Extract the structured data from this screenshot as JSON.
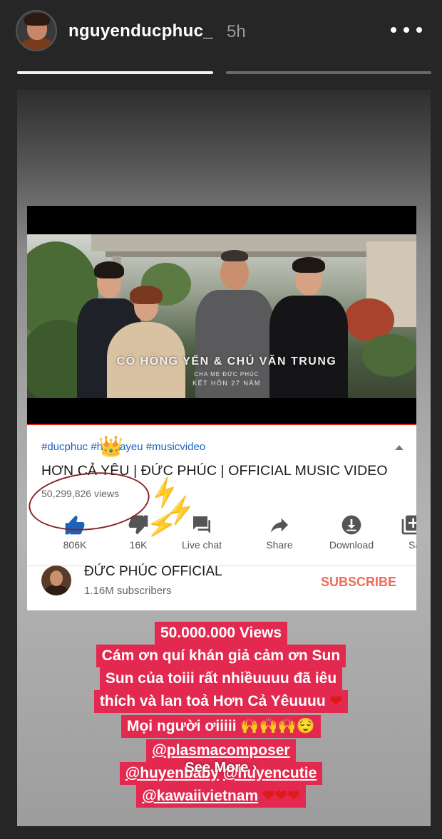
{
  "header": {
    "username": "nguyenducphuc_",
    "time": "5h"
  },
  "story": {
    "progress_fraction_segment_1": 1.0,
    "segment_count": 2
  },
  "youtube": {
    "video_caption_main": "CÔ HỒNG YẾN & CHÚ VĂN TRUNG",
    "video_caption_sub": "CHA MẸ ĐỨC PHÚC",
    "video_caption_sub2": "KẾT HÔN 27 NĂM",
    "hashtags": "#ducphuc #honcayeu #musicvideo",
    "title": "HƠN CẢ YÊU | ĐỨC PHÚC | OFFICIAL MUSIC VIDEO",
    "views": "50,299,826 views",
    "actions": [
      {
        "label": "806K",
        "icon": "thumbs-up-icon"
      },
      {
        "label": "16K",
        "icon": "thumbs-down-icon"
      },
      {
        "label": "Live chat",
        "icon": "chat-icon"
      },
      {
        "label": "Share",
        "icon": "share-icon"
      },
      {
        "label": "Download",
        "icon": "download-icon"
      },
      {
        "label": "Sa",
        "icon": "save-icon"
      }
    ],
    "channel": {
      "name": "ĐỨC PHÚC OFFICIAL",
      "subscribers": "1.16M subscribers",
      "subscribe_label": "SUBSCRIBE"
    }
  },
  "caption": {
    "line1": "50.000.000 Views",
    "line2": "Cám ơn quí khán giả cảm ơn Sun",
    "line3": "Sun của toiii rất nhiềuuuu đã iêu",
    "line4": "thích và lan toả Hơn Cả Yêuuuu",
    "line5": "Mọi người ơiiiii",
    "mention1": "@plasmacomposer",
    "mention2": "@huyenbaby",
    "mention3": "@huyencutie",
    "mention4": "@kawaiivietnam"
  },
  "see_more": "See More",
  "colors": {
    "caption_bg": "#e3294f",
    "subscribe": "#f06a5a",
    "hashtag": "#1c62b9",
    "like_active": "#1c62b9"
  }
}
